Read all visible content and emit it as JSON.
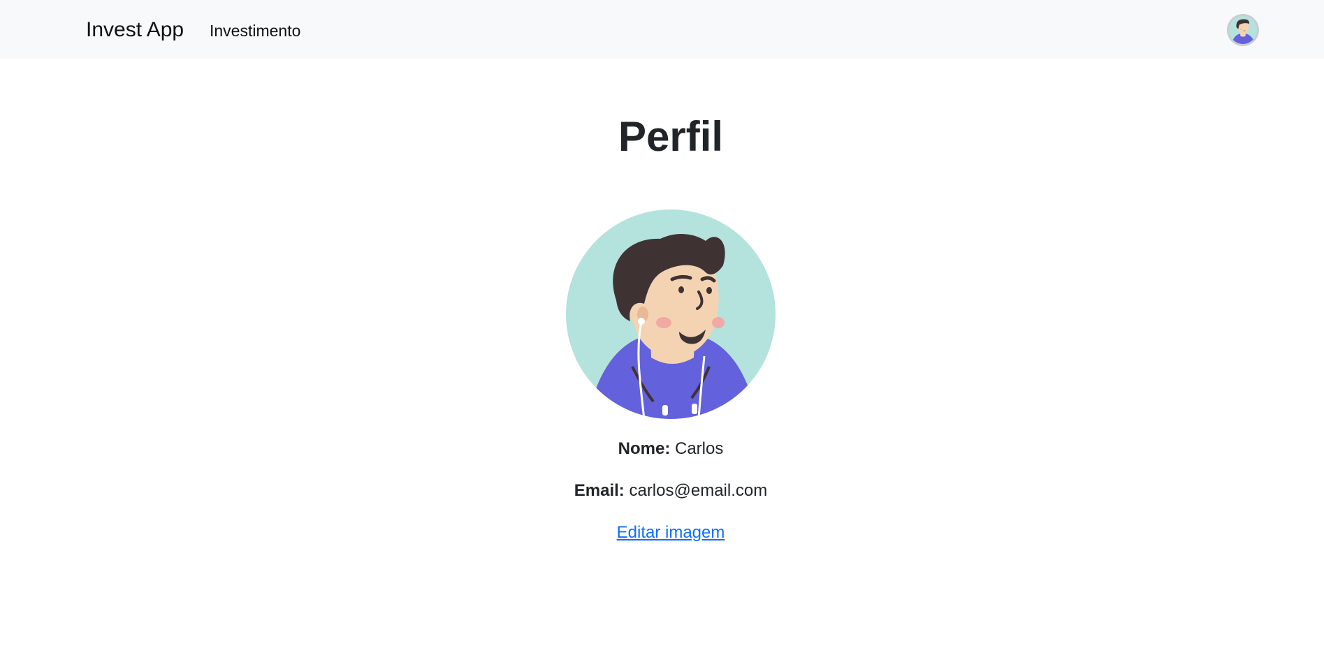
{
  "navbar": {
    "brand": "Invest App",
    "links": [
      {
        "label": "Investimento"
      }
    ],
    "avatar_icon": "user-avatar-icon"
  },
  "main": {
    "title": "Perfil",
    "avatar_icon": "user-avatar-illustration",
    "fields": {
      "name_label": "Nome:",
      "name_value": "Carlos",
      "email_label": "Email:",
      "email_value": "carlos@email.com"
    },
    "edit_image_link": "Editar imagem"
  },
  "colors": {
    "navbar_bg": "#f8f9fa",
    "link": "#0d6efd",
    "avatar_bg": "#b4e2dd",
    "hoodie": "#6461dc",
    "hair": "#3e3233",
    "skin": "#f4d3b3"
  }
}
